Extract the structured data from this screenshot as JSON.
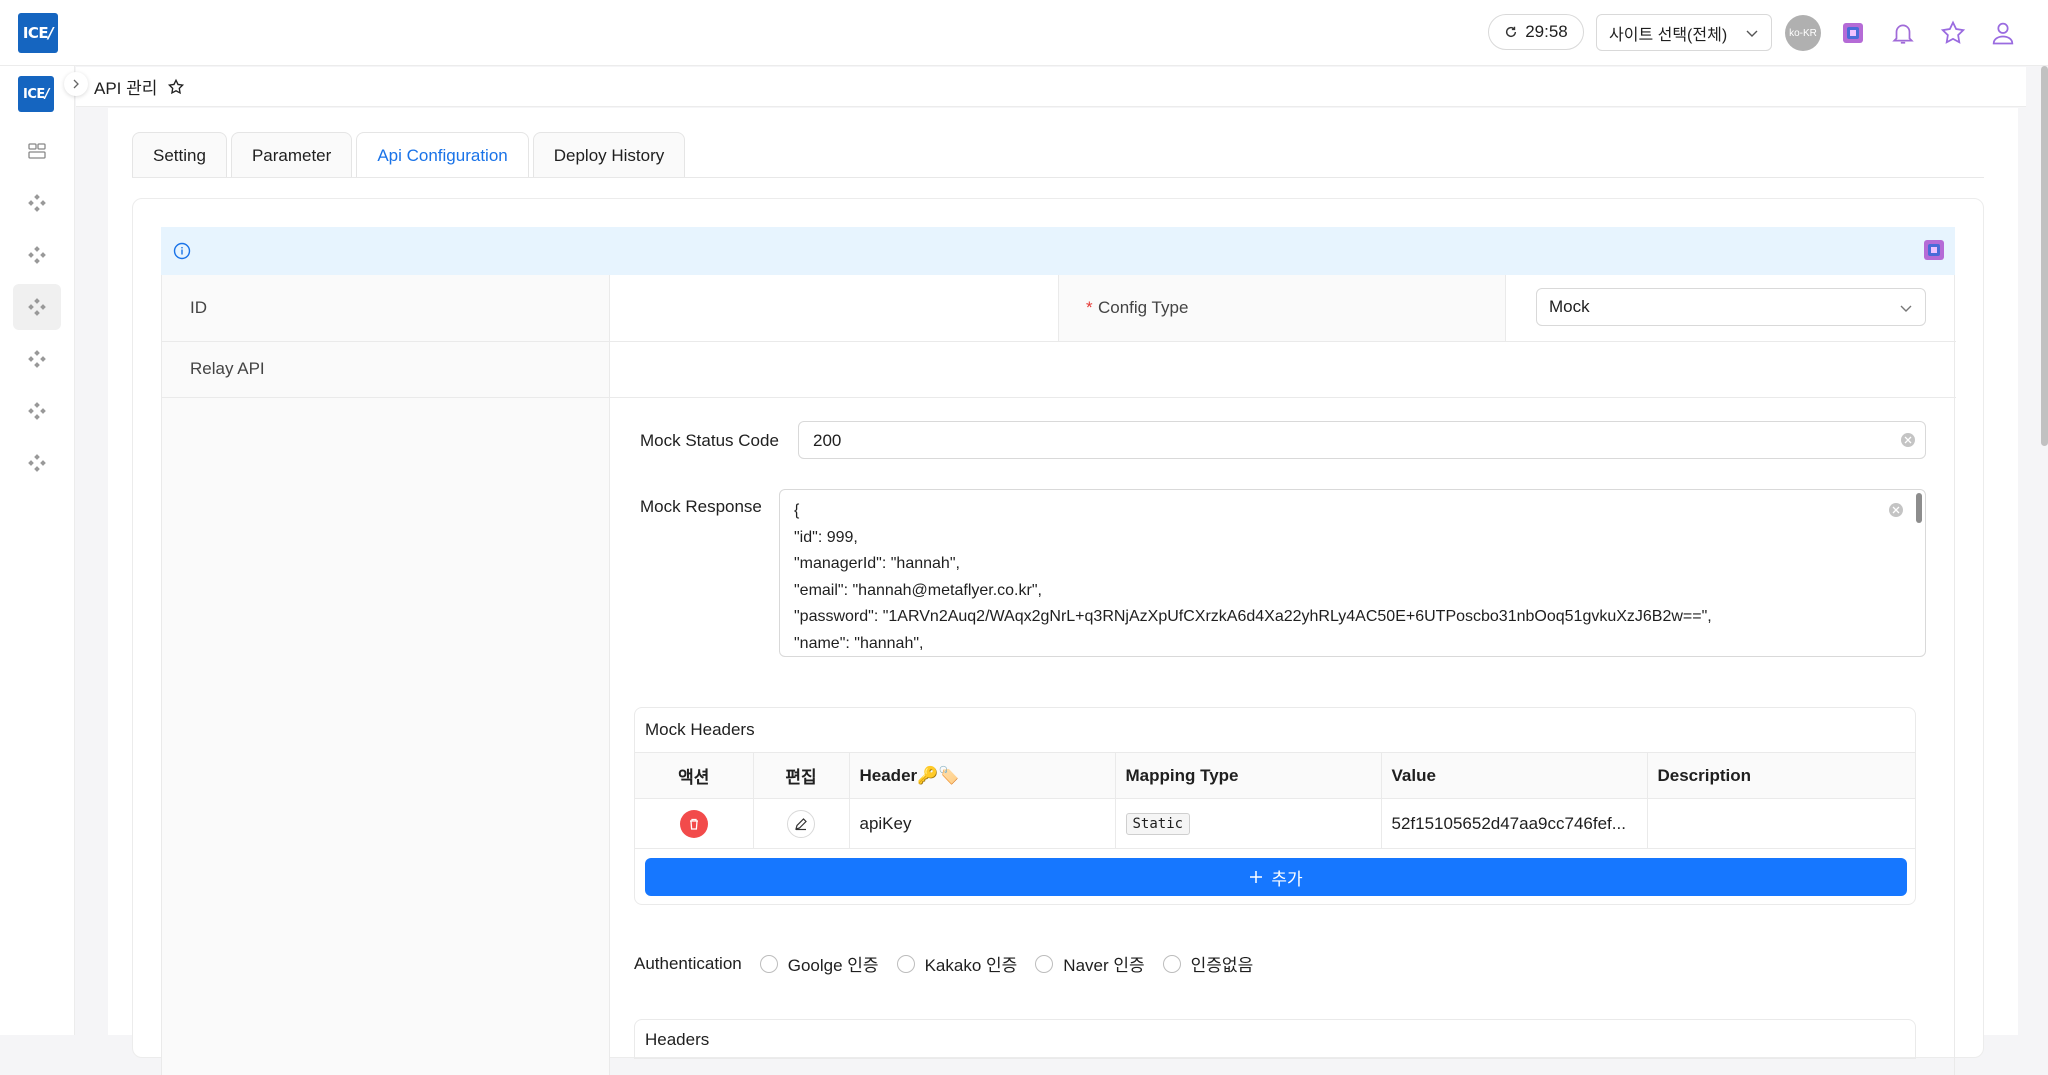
{
  "header": {
    "logo_text": "ICE",
    "timer": "29:58",
    "site_select": "사이트 선택(전체)",
    "lang_badge": "ko-KR"
  },
  "sidebar": {
    "logo_text": "ICE",
    "items": [
      "dashboard-icon",
      "module-icon",
      "module-icon",
      "module-icon",
      "module-icon",
      "module-icon",
      "module-icon"
    ]
  },
  "breadcrumb": {
    "title": "API 관리"
  },
  "tabs": [
    "Setting",
    "Parameter",
    "Api Configuration",
    "Deploy History"
  ],
  "form": {
    "id_label": "ID",
    "id_value": "",
    "config_type_required": "*",
    "config_type_label": "Config Type",
    "config_type_value": "Mock",
    "relay_api_label": "Relay API",
    "mock_status_label": "Mock Status Code",
    "mock_status_value": "200",
    "mock_response_label": "Mock Response",
    "mock_response_value": "{\n\"id\": 999,\n\"managerId\": \"hannah\",\n\"email\": \"hannah@metaflyer.co.kr\",\n\"password\": \"1ARVn2Auq2/WAqx2gNrL+q3RNjAzXpUfCXrzkA6d4Xa22yhRLy4AC50E+6UTPoscbo31nbOoq51gvkuXzJ6B2w==\",\n\"name\": \"hannah\","
  },
  "mock_headers": {
    "title": "Mock Headers",
    "columns": [
      "액션",
      "편집",
      "Header🔑🏷️",
      "Mapping Type",
      "Value",
      "Description"
    ],
    "rows": [
      {
        "header": "apiKey",
        "mapping_type": "Static",
        "value": "52f15105652d47aa9cc746fef...",
        "description": ""
      }
    ],
    "add_label": "추가"
  },
  "auth": {
    "label": "Authentication",
    "options": [
      "Goolge 인증",
      "Kakako 인증",
      "Naver 인증",
      "인증없음"
    ]
  },
  "headers_section": {
    "title": "Headers"
  },
  "colors": {
    "accent": "#1a73e8",
    "primary_button": "#1677ff",
    "danger": "#f24b4b",
    "info_bg": "#e7f4fe",
    "logo": "#1565c0"
  }
}
